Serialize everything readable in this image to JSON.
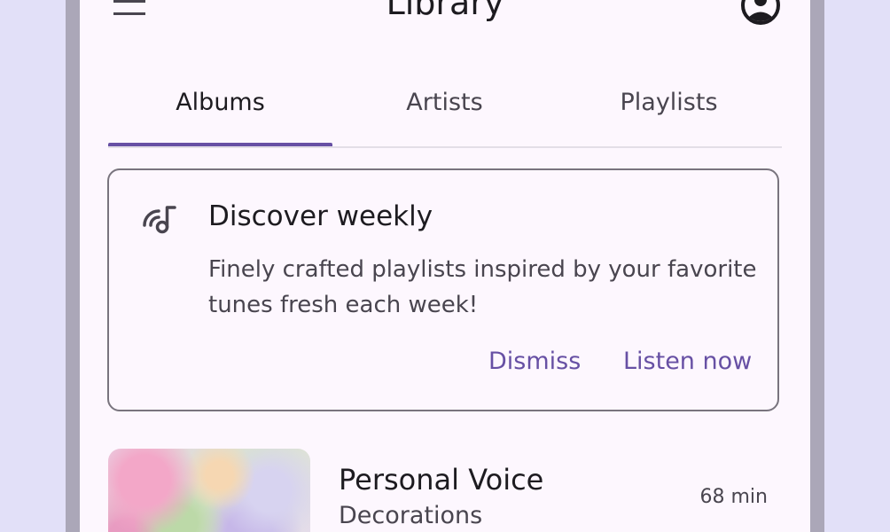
{
  "appbar": {
    "title": "Library",
    "menu_icon": "menu-icon",
    "account_icon": "account-circle-icon"
  },
  "tabs": [
    {
      "label": "Albums",
      "active": true
    },
    {
      "label": "Artists",
      "active": false
    },
    {
      "label": "Playlists",
      "active": false
    }
  ],
  "promo_card": {
    "icon": "podcasts-music-icon",
    "title": "Discover weekly",
    "body": "Finely crafted playlists inspired by your favorite tunes fresh each week!",
    "dismiss_label": "Dismiss",
    "listen_label": "Listen now"
  },
  "albums": [
    {
      "title": "Personal Voice",
      "artist": "Decorations",
      "duration": "68 min"
    }
  ],
  "colors": {
    "primary": "#6750a4",
    "surface": "#fdf7fe",
    "outline": "#79747e",
    "background": "#e2e0f8"
  }
}
